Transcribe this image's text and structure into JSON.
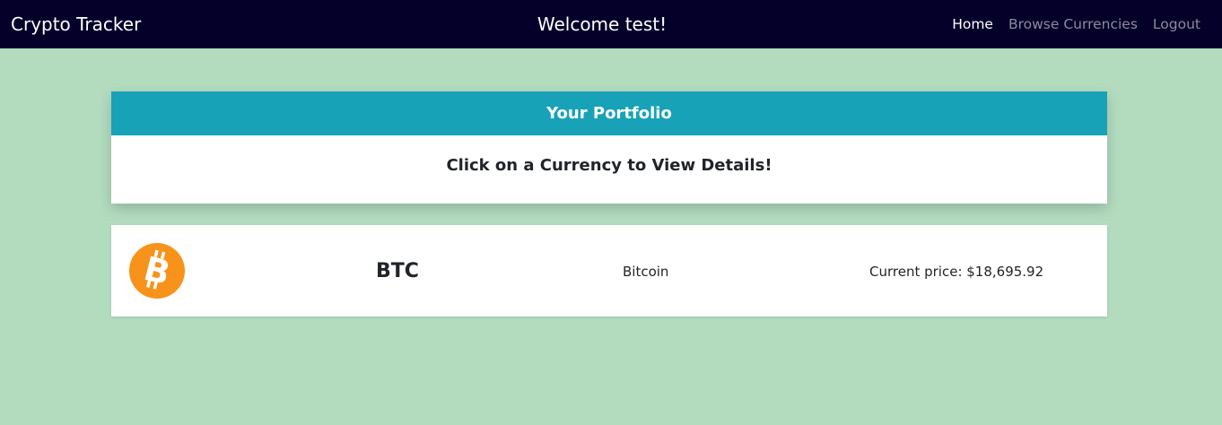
{
  "navbar": {
    "brand": "Crypto Tracker",
    "welcome": "Welcome test!",
    "links": [
      {
        "label": "Home",
        "active": true
      },
      {
        "label": "Browse Currencies",
        "active": false
      },
      {
        "label": "Logout",
        "active": false
      }
    ]
  },
  "portfolio": {
    "title": "Your Portfolio",
    "instruction": "Click on a Currency to View Details!"
  },
  "currencies": [
    {
      "symbol": "BTC",
      "name": "Bitcoin",
      "price_text": "Current price: $18,695.92",
      "icon": "bitcoin-logo-icon",
      "icon_color": "#f7931a"
    }
  ],
  "colors": {
    "navbar_bg": "#04002a",
    "page_bg": "#b3dcbf",
    "header_accent": "#18a2b8"
  }
}
